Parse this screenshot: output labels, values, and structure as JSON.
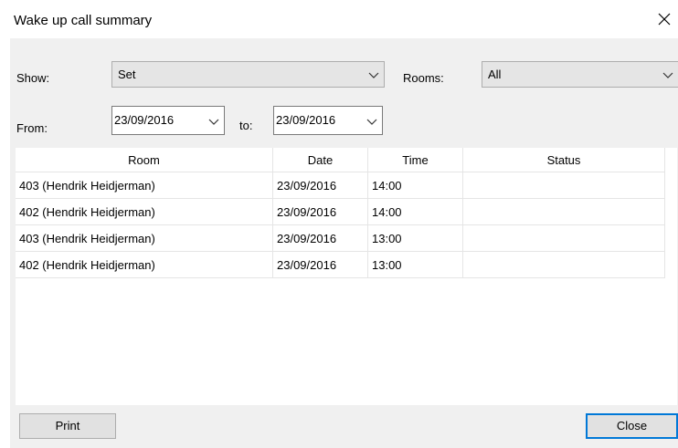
{
  "window": {
    "title": "Wake up call summary"
  },
  "filters": {
    "show_label": "Show:",
    "show_value": "Set",
    "rooms_label": "Rooms:",
    "rooms_value": "All",
    "from_label": "From:",
    "from_value": "23/09/2016",
    "to_label": "to:",
    "to_value": "23/09/2016"
  },
  "table": {
    "columns": [
      "Room",
      "Date",
      "Time",
      "Status"
    ],
    "rows": [
      [
        "403 (Hendrik Heidjerman)",
        "23/09/2016",
        "14:00",
        ""
      ],
      [
        "402 (Hendrik Heidjerman)",
        "23/09/2016",
        "14:00",
        ""
      ],
      [
        "403 (Hendrik Heidjerman)",
        "23/09/2016",
        "13:00",
        ""
      ],
      [
        "402 (Hendrik Heidjerman)",
        "23/09/2016",
        "13:00",
        ""
      ]
    ]
  },
  "buttons": {
    "print": "Print",
    "close": "Close"
  },
  "icons": {
    "close": "close-icon",
    "dropdown": "chevron-down-icon"
  }
}
